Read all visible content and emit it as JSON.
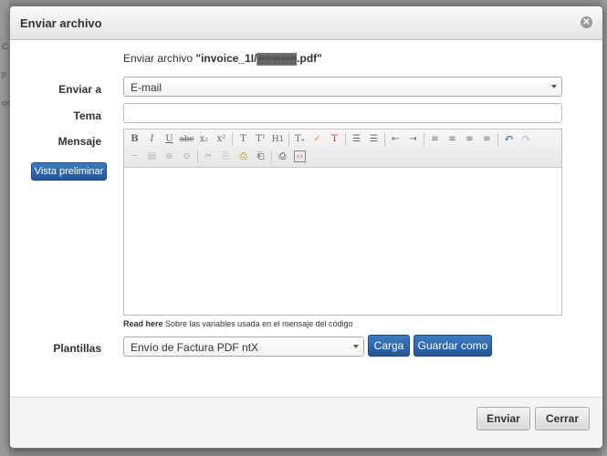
{
  "dialog": {
    "title": "Enviar archivo",
    "close_icon": "close-icon"
  },
  "file_line": {
    "prefix": "Enviar archivo ",
    "filename": "\"invoice_1I/▓▓▓▓▓.pdf\""
  },
  "fields": {
    "send_to_label": "Enviar a",
    "send_to_value": "E-mail",
    "subject_label": "Tema",
    "subject_value": "",
    "message_label": "Mensaje",
    "templates_label": "Plantillas",
    "templates_value": "Envío de Factura PDF ntX"
  },
  "editor": {
    "row1": [
      "B",
      "I",
      "U",
      "abc",
      "x₂",
      "x²",
      "T",
      "T¹",
      "H1",
      "Tₓ",
      "✓",
      "T",
      "☰",
      "☰",
      "⇤",
      "⇥",
      "≡",
      "≡",
      "≡",
      "≡",
      "↶",
      "↷"
    ],
    "row2": [
      "─",
      "▤",
      "⊕",
      "⊖",
      "✂",
      "⎘",
      "⎙",
      "⎗",
      "⎙",
      "‹›"
    ]
  },
  "buttons": {
    "preview": "Vista preliminar",
    "load": "Carga",
    "save_as": "Guardar como",
    "send": "Enviar",
    "close": "Cerrar"
  },
  "help": {
    "read_here": "Read here",
    "text": " Sobre las variables usada en el mensaje del código"
  },
  "colors": {
    "primary_button": "#2a63a8",
    "header_bg": "#e8e8e8"
  }
}
